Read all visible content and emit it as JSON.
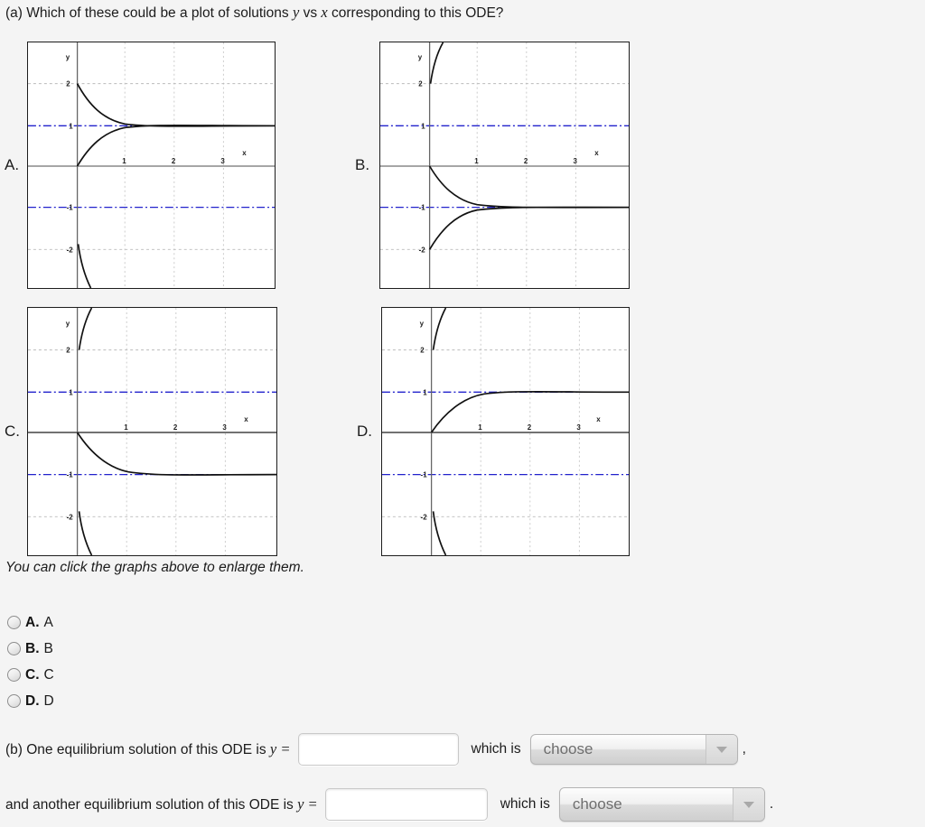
{
  "question": {
    "part_a_prefix": "(a) Which of these could be a plot of solutions ",
    "var_y": "y",
    "mid": " vs ",
    "var_x": "x",
    "part_a_suffix": " corresponding to this ODE?"
  },
  "graphs": {
    "labels": {
      "a": "A.",
      "b": "B.",
      "c": "C.",
      "d": "D."
    },
    "axis": {
      "x_label": "x",
      "y_label": "y",
      "x_ticks": [
        "1",
        "2",
        "3"
      ],
      "y_ticks": [
        "2",
        "1",
        "-1",
        "-2"
      ]
    },
    "equilibrium_line_color": "#2222cc",
    "curve_color": "#111111",
    "grid_color": "#cccccc",
    "panels": [
      {
        "id": "A",
        "description": "Solutions converge to y = 1 from above and below; a steep solution diverges downward below y = -2.",
        "asymptotes": [
          1,
          -1
        ],
        "attracting": 1,
        "repelling": -1
      },
      {
        "id": "B",
        "description": "Solutions converge to y = -1 from above and below; a steep solution diverges upward above y = 2.",
        "asymptotes": [
          1,
          -1
        ],
        "attracting": -1,
        "repelling": 1
      },
      {
        "id": "C",
        "description": "Solution starting at y = 0 decays to y = -1; steep solutions diverge upward above y = 2 and downward below y = -2.",
        "asymptotes": [
          1,
          -1
        ],
        "attracting": -1,
        "repelling": 1
      },
      {
        "id": "D",
        "description": "Solution starting at y = 0 rises to y = 1; steep solutions diverge upward above y = 2 and downward below y = -2.",
        "asymptotes": [
          1,
          -1
        ],
        "attracting": 1,
        "repelling": -1
      }
    ]
  },
  "click_note": "You can click the graphs above to enlarge them.",
  "options": [
    {
      "letter": "A.",
      "value": "A"
    },
    {
      "letter": "B.",
      "value": "B"
    },
    {
      "letter": "C.",
      "value": "C"
    },
    {
      "letter": "D.",
      "value": "D"
    }
  ],
  "part_b": {
    "label_prefix": "(b) One equilibrium solution of this ODE is ",
    "var_y": "y",
    "equals": " =",
    "input_value": "",
    "input_placeholder": "",
    "which_is": "which is",
    "dropdown_value": "choose",
    "trailing": ","
  },
  "part_c": {
    "label_prefix": "and another equilibrium solution of this ODE is ",
    "var_y": "y",
    "equals": " =",
    "input_value": "",
    "input_placeholder": "",
    "which_is": "which is",
    "dropdown_value": "choose",
    "trailing": "."
  },
  "colors": {
    "page_background": "#f4f4f4",
    "panel_background": "#ffffff",
    "text": "#1b1b1b"
  }
}
